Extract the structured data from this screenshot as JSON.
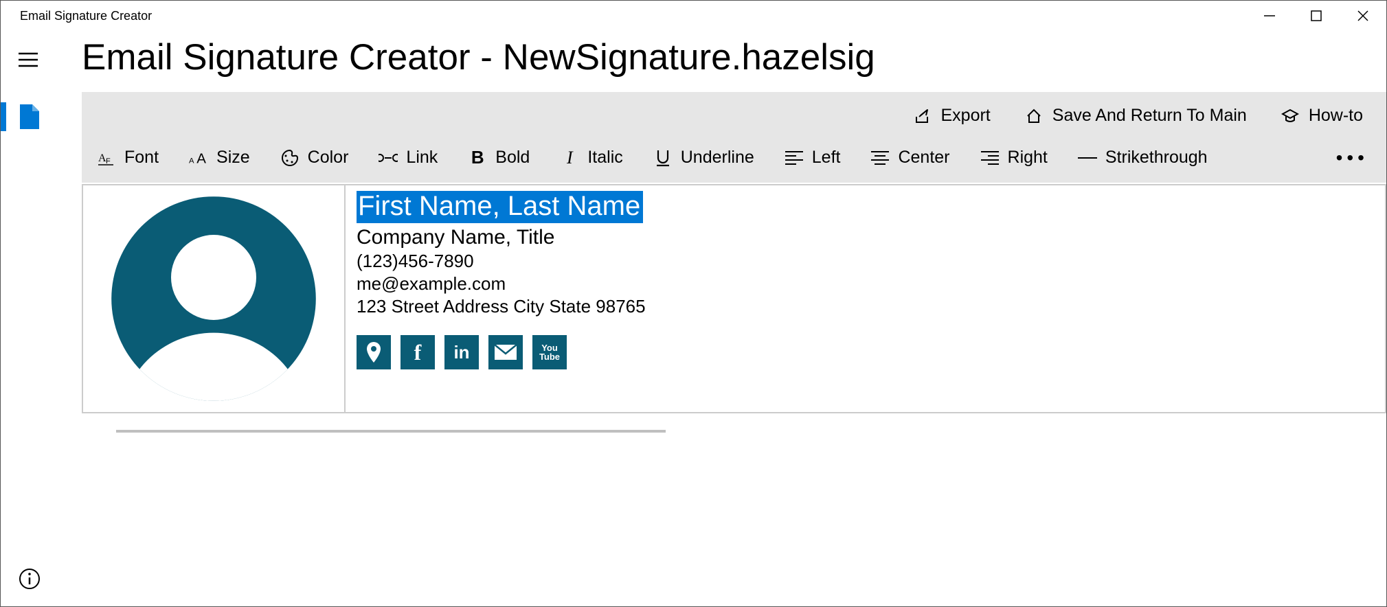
{
  "window": {
    "app_title": "Email Signature Creator"
  },
  "page": {
    "title": "Email Signature Creator - NewSignature.hazelsig"
  },
  "ribbon_top": {
    "export": "Export",
    "save_return": "Save And Return To Main",
    "howto": "How-to"
  },
  "toolbar": {
    "font": "Font",
    "size": "Size",
    "color": "Color",
    "link": "Link",
    "bold": "Bold",
    "italic": "Italic",
    "underline": "Underline",
    "left": "Left",
    "center": "Center",
    "right": "Right",
    "strike": "Strikethrough"
  },
  "signature": {
    "name": "First Name, Last Name",
    "company": "Company Name, Title",
    "phone": "(123)456-7890",
    "email": "me@example.com",
    "address": "123 Street Address City State 98765"
  },
  "social": {
    "location": "location-icon",
    "facebook": "facebook-icon",
    "linkedin": "linkedin-icon",
    "mail": "mail-icon",
    "youtube": "youtube-icon"
  },
  "colors": {
    "accent": "#0078d4",
    "teal": "#0a5c75",
    "ribbon_bg": "#e6e6e6"
  }
}
